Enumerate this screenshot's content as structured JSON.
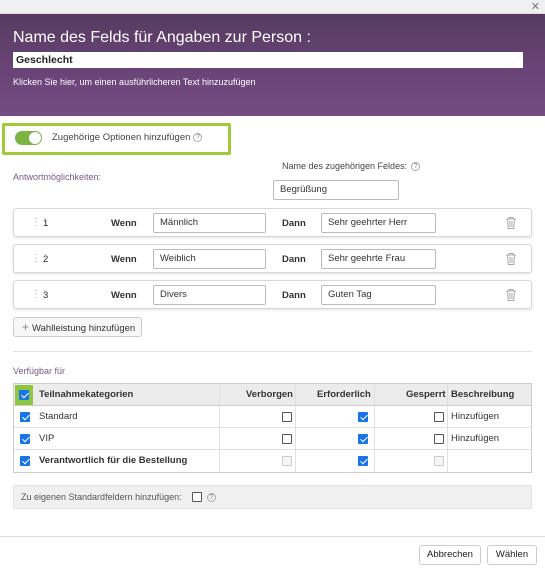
{
  "header": {
    "title": "Name des Felds für Angaben zur Person :",
    "field_value": "Geschlecht",
    "hint": "Klicken Sie hier, um einen ausführlicheren Text hinzuzufügen"
  },
  "options_toggle": {
    "label": "Zugehörige Optionen hinzufügen",
    "enabled": true
  },
  "answers_label": "Antwortmöglichkeiten:",
  "related_field": {
    "label": "Name des zugehörigen Feldes:",
    "value": "Begrüßung"
  },
  "rows": [
    {
      "num": "1",
      "wenn": "Wenn",
      "if_value": "Männlich",
      "dann": "Dann",
      "then_value": "Sehr geehrter Herr"
    },
    {
      "num": "2",
      "wenn": "Wenn",
      "if_value": "Weiblich",
      "dann": "Dann",
      "then_value": "Sehr geehrte Frau"
    },
    {
      "num": "3",
      "wenn": "Wenn",
      "if_value": "Divers",
      "dann": "Dann",
      "then_value": "Guten Tag"
    }
  ],
  "add_choice_label": "Wahlleistung hinzufügen",
  "available_label": "Verfügbar für",
  "table": {
    "headers": {
      "category": "Teilnahmekategorien",
      "hidden": "Verborgen",
      "required": "Erforderlich",
      "locked": "Gesperrt",
      "description": "Beschreibung"
    },
    "rows": [
      {
        "name": "Standard",
        "description": "Hinzufügen"
      },
      {
        "name": "VIP",
        "description": "Hinzufügen"
      },
      {
        "name": "Verantwortlich für die Bestellung",
        "description": ""
      }
    ]
  },
  "std_fields_label": "Zu eigenen Standardfeldern hinzufügen:",
  "footer": {
    "cancel": "Abbrechen",
    "select": "Wählen"
  },
  "colors": {
    "header": "#6a4477",
    "accent_green": "#8dc63f",
    "checkbox_blue": "#1a73e8"
  }
}
